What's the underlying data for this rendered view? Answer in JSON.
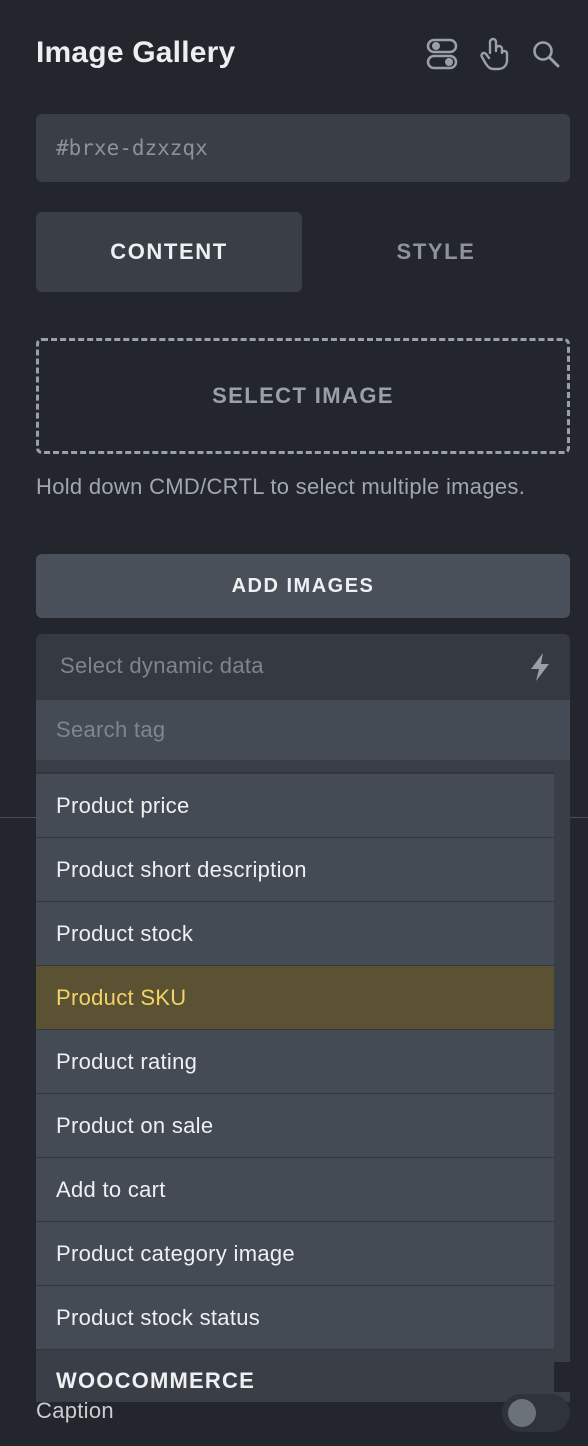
{
  "panel": {
    "title": "Image Gallery"
  },
  "header_icons": [
    "toggles-icon",
    "hand-pointer-icon",
    "search-icon"
  ],
  "element_id": "#brxe-dzxzqx",
  "tabs": [
    {
      "label": "CONTENT",
      "active": true
    },
    {
      "label": "STYLE",
      "active": false
    }
  ],
  "gallery": {
    "select_image_label": "SELECT IMAGE",
    "hint": "Hold down CMD/CRTL to select multiple images.",
    "add_images_label": "ADD IMAGES"
  },
  "dynamic_data": {
    "placeholder": "Select dynamic data",
    "icon": "bolt-icon",
    "search_placeholder": "Search tag",
    "items": [
      "Product price",
      "Product short description",
      "Product stock",
      "Product SKU",
      "Product rating",
      "Product on sale",
      "Add to cart",
      "Product category image",
      "Product stock status"
    ],
    "highlighted_item": "Product SKU",
    "group_label": "WOOCOMMERCE"
  },
  "caption": {
    "label": "Caption",
    "enabled": false
  },
  "colors": {
    "background": "#23262c",
    "field": "#3a3f47",
    "highlight_bg": "#5b5233",
    "highlight_text": "#f2d466"
  }
}
